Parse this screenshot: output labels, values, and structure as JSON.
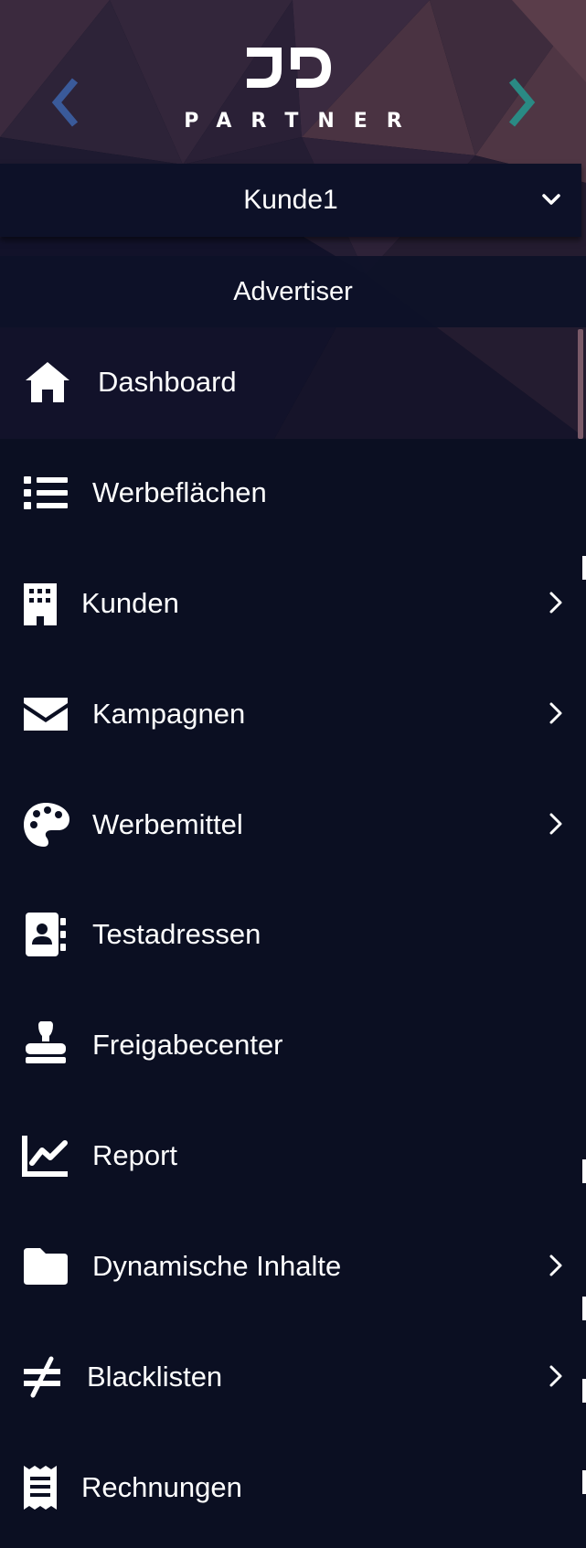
{
  "header": {
    "logo_text": "PARTNER",
    "logo_mark": "JD",
    "prev_icon": "chevron-left-icon",
    "next_icon": "chevron-right-icon"
  },
  "client_select": {
    "value": "Kunde1",
    "icon": "chevron-down-icon"
  },
  "role": {
    "label": "Advertiser"
  },
  "menu": {
    "items": [
      {
        "label": "Dashboard",
        "icon": "home-icon",
        "has_submenu": false
      },
      {
        "label": "Werbeflächen",
        "icon": "list-icon",
        "has_submenu": false
      },
      {
        "label": "Kunden",
        "icon": "building-icon",
        "has_submenu": true
      },
      {
        "label": "Kampagnen",
        "icon": "envelope-icon",
        "has_submenu": true
      },
      {
        "label": "Werbemittel",
        "icon": "palette-icon",
        "has_submenu": true
      },
      {
        "label": "Testadressen",
        "icon": "address-book-icon",
        "has_submenu": false
      },
      {
        "label": "Freigabecenter",
        "icon": "stamp-icon",
        "has_submenu": false
      },
      {
        "label": "Report",
        "icon": "chart-line-icon",
        "has_submenu": false
      },
      {
        "label": "Dynamische Inhalte",
        "icon": "folder-icon",
        "has_submenu": true
      },
      {
        "label": "Blacklisten",
        "icon": "not-equal-icon",
        "has_submenu": true
      },
      {
        "label": "Rechnungen",
        "icon": "receipt-icon",
        "has_submenu": false
      }
    ]
  },
  "colors": {
    "background": "#0b0f22",
    "panel": "#0d1128",
    "arrow_left": "#3a5a9a",
    "arrow_right": "#2a8a84",
    "text": "#ffffff"
  }
}
